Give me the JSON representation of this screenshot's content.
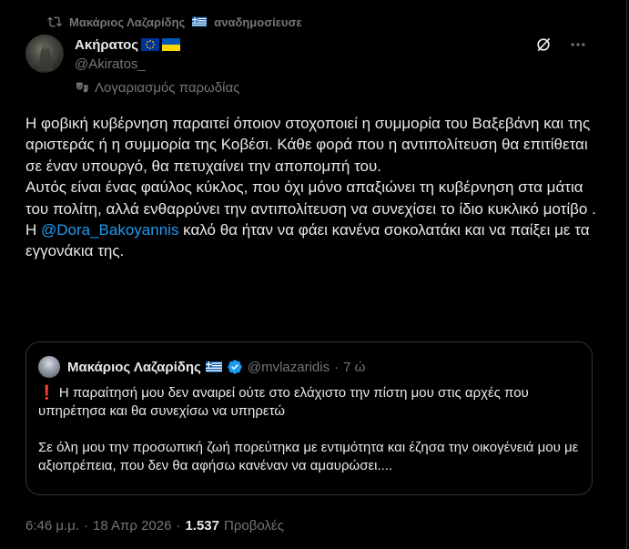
{
  "repost": {
    "user": "Μακάριος Λαζαρίδης",
    "action": "αναδημοσίευσε",
    "icon": "repost-icon"
  },
  "author": {
    "name": "Ακήρατος",
    "handle": "@Akiratos_",
    "parody_label": "Λογαριασμός παρωδίας",
    "verified_badge_color": "#1d9bf0"
  },
  "post": {
    "paragraphs": [
      "Η φοβική κυβέρνηση παραιτεί όποιον στοχοποιεί η συμμορία του Βαξεβάνη και της αριστεράς ή η συμμορία της Κοβέσι. Κάθε φορά που η αντιπολίτευση θα επιτίθεται σε έναν υπουργό, θα πετυχαίνει την αποπομπή του.",
      "Αυτός είναι ένας φαύλος κύκλος, που όχι μόνο απαξιώνει τη κυβέρνηση στα μάτια του πολίτη, αλλά ενθαρρύνει την αντιπολίτευση να συνεχίσει το ίδιο κυκλικό μοτίβο ."
    ],
    "last_prefix": "Η ",
    "mention": "@Dora_Bakoyannis",
    "last_suffix": " καλό θα ήταν να φάει κανένα σοκολατάκι και να παίξει με τα εγγονάκια της."
  },
  "quote": {
    "name": "Μακάριος Λαζαρίδης",
    "handle": "@mvlazaridis",
    "dot": "·",
    "time": "7 ώ",
    "line1_mark": "❗",
    "line1": " Η παραίτησή μου δεν αναιρεί ούτε στο ελάχιστο την πίστη μου στις αρχές που υπηρέτησα και θα συνεχίσω να υπηρετώ",
    "line2": "Σε όλη μου την προσωπική ζωή πορεύτηκα με εντιμότητα και έζησα την οικογένειά μου με αξιοπρέπεια, που δεν θα αφήσω κανέναν να αμαυρώσει...."
  },
  "meta": {
    "time": "6:46 μ.μ.",
    "sep1": "·",
    "date": "18 Απρ 2026",
    "sep2": "·",
    "views": "1.537",
    "views_label": "Προβολές"
  },
  "colors": {
    "background": "#000000",
    "text": "#e7e9ea",
    "secondary": "#71767b",
    "accent": "#1d9bf0",
    "border": "#2f3336"
  }
}
